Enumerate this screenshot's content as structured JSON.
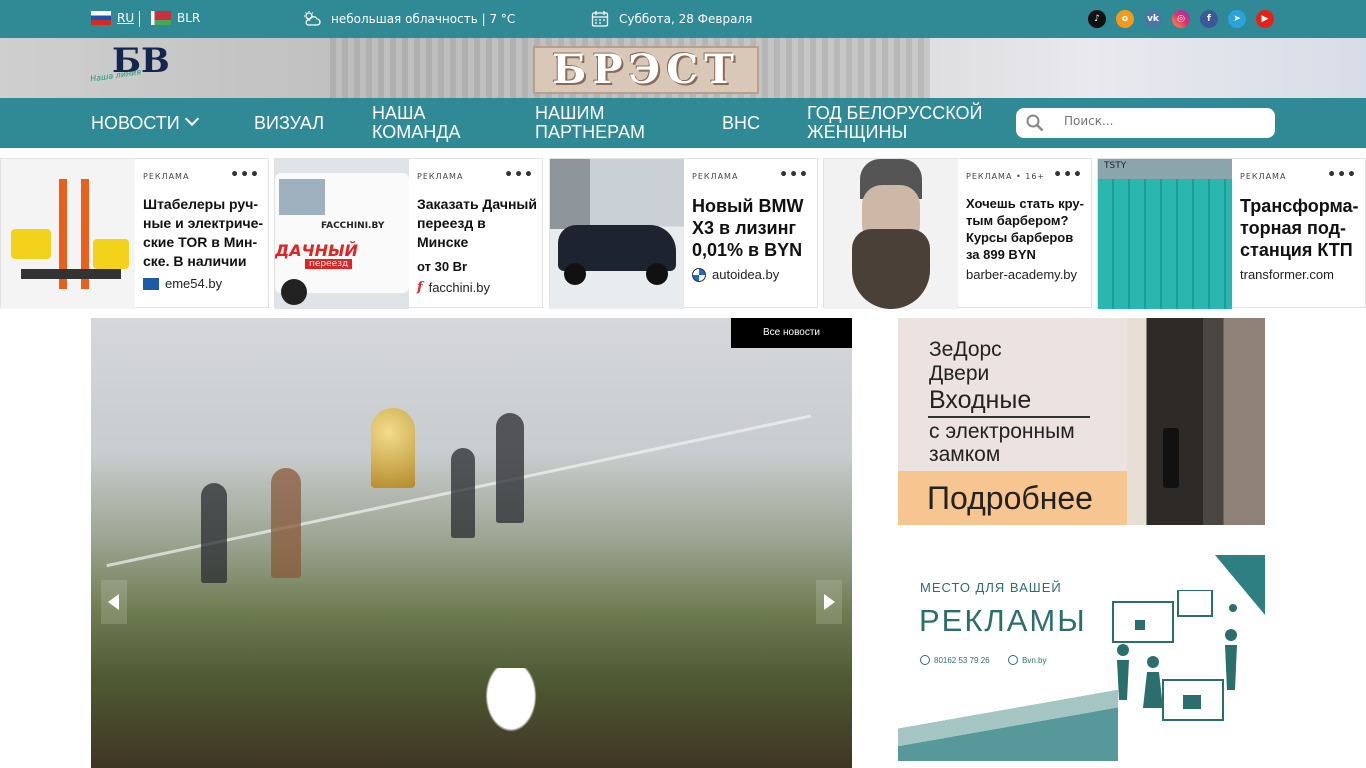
{
  "topbar": {
    "lang_ru": "RU",
    "lang_by": "BLR",
    "weather": "небольшая облачность | 7 °C",
    "date": "Суббота, 28 Февраля",
    "socials": [
      "tiktok-icon",
      "odnoklassniki-icon",
      "vk-icon",
      "instagram-icon",
      "facebook-icon",
      "telegram-icon",
      "youtube-icon"
    ],
    "bg_color": "#2f8a96"
  },
  "banner": {
    "sign": "БРЭСТ",
    "logo_text": "БВ",
    "logo_sub": "Наша линия"
  },
  "nav": {
    "items": [
      "Новости",
      "Визуал",
      "Наша команда",
      "Нашим партнерам",
      "ВНС",
      "Год белорусской женщины"
    ],
    "search_placeholder": "Поиск..."
  },
  "ads": [
    {
      "label": "РЕКЛАМА",
      "title": "Штабелеры руч-ные и электриче-ские TOR в Мин-ске. В наличии",
      "price": "",
      "domain": "eme54.by"
    },
    {
      "label": "РЕКЛАМА",
      "title": "Заказать Дачный переезд в Минске",
      "price": "от 30 Br",
      "domain": "facchini.by",
      "img_text1": "FACCHINI.BY",
      "img_text2": "ДАЧНЫЙ",
      "img_text3": "переезд"
    },
    {
      "label": "РЕКЛАМА",
      "title": "Новый BMW X3 в лизинг 0,01% в BYN",
      "price": "",
      "domain": "autoidea.by"
    },
    {
      "label": "РЕКЛАМА • 16+",
      "title": "Хочешь стать кру-тым барбером? Курсы барберов за 899 BYN",
      "price": "",
      "domain": "barber-academy.by"
    },
    {
      "label": "РЕКЛАМА",
      "title": "Трансформа-торная под-станция КТП",
      "price": "",
      "domain": "transformer.com"
    }
  ],
  "slider": {
    "all_news": "Все новости"
  },
  "side_ad_1": {
    "line1": "ЗеДорс",
    "line2": "Двери",
    "line3": "Входные",
    "line4": "с электронным",
    "line5": "замком",
    "button": "Подробнее"
  },
  "side_ad_2": {
    "small": "МЕСТО ДЛЯ ВАШЕЙ",
    "big": "РЕКЛАМЫ",
    "phone": "80162 53 79 26",
    "site": "Bvn.by"
  }
}
